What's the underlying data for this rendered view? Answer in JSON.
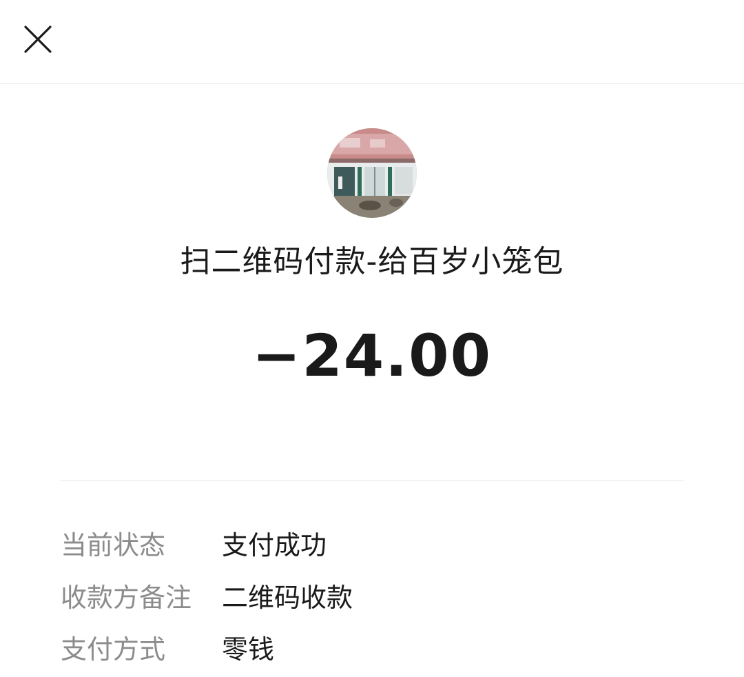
{
  "header": {
    "close_icon": "close-icon"
  },
  "merchant": {
    "avatar_icon": "shop-storefront-photo",
    "title": "扫二维码付款-给百岁小笼包"
  },
  "transaction": {
    "amount": "−24.00"
  },
  "details": [
    {
      "label": "当前状态",
      "value": "支付成功"
    },
    {
      "label": "收款方备注",
      "value": "二维码收款"
    },
    {
      "label": "支付方式",
      "value": "零钱"
    }
  ],
  "colors": {
    "primary_text": "#1a1a1a",
    "secondary_text": "#8c8c8c",
    "divider": "#e6e6e6",
    "background": "#ffffff"
  }
}
